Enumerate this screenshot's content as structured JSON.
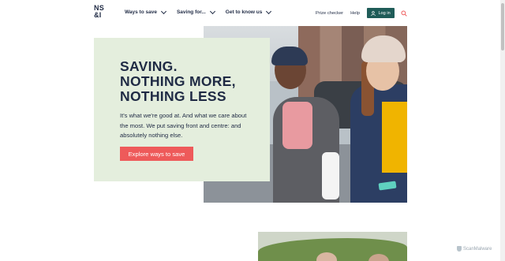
{
  "brand": {
    "logo_text": "NS\n&I"
  },
  "nav": {
    "items": [
      {
        "label": "Ways to save"
      },
      {
        "label": "Saving for..."
      },
      {
        "label": "Get to know us"
      }
    ]
  },
  "util": {
    "prize_checker": "Prize checker",
    "help": "Help",
    "login": "Log in"
  },
  "hero": {
    "title": "SAVING.\nNOTHING MORE,\nNOTHING LESS",
    "text": "It's what we're good at. And what we care about the most. We put saving front and centre: and absolutely nothing else.",
    "cta": "Explore ways to save"
  },
  "watermark": {
    "text": "ScanMalware"
  },
  "colors": {
    "brand_teal": "#1f5c58",
    "cta_red": "#ee5a5a",
    "navy": "#1f2a44",
    "card_green": "#e4eedd"
  }
}
